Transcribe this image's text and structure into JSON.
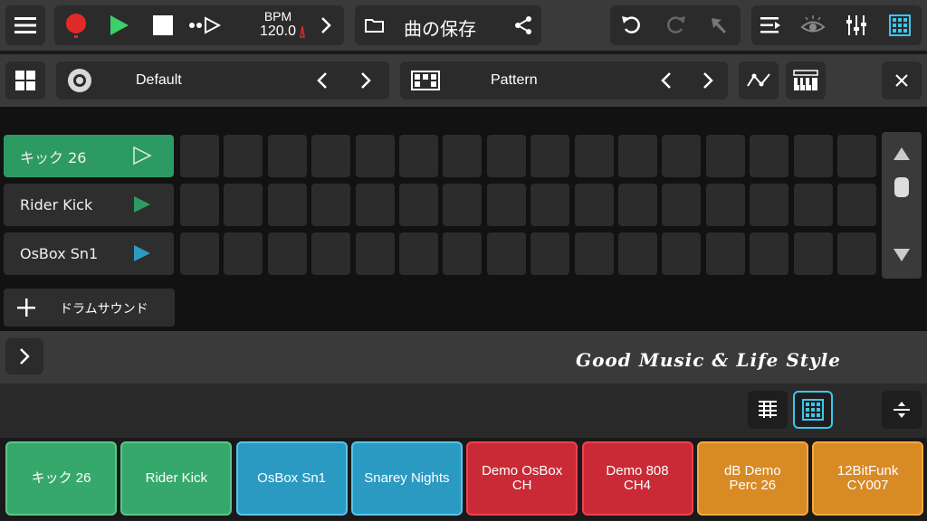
{
  "toolbar": {
    "bpm_label": "BPM",
    "bpm_value": "120.0",
    "song_title": "曲の保存"
  },
  "kit": {
    "name": "Default",
    "pattern": "Pattern"
  },
  "tracks": [
    {
      "name": "キック 26",
      "active": true,
      "play_color": "#2e9a63"
    },
    {
      "name": "Rider Kick",
      "active": false,
      "play_color": "#2e9a63"
    },
    {
      "name": "OsBox Sn1",
      "active": false,
      "play_color": "#2b9ac2"
    }
  ],
  "add_drum_sound": "ドラムサウンド",
  "watermark": "Good Music & Life Style",
  "pads": [
    {
      "label": "キック 26",
      "color": "green"
    },
    {
      "label": "Rider Kick",
      "color": "green"
    },
    {
      "label": "OsBox Sn1",
      "color": "blue"
    },
    {
      "label": "Snarey Nights",
      "color": "blue"
    },
    {
      "label": "Demo OsBox\nCH",
      "color": "red"
    },
    {
      "label": "Demo 808\nCH4",
      "color": "red"
    },
    {
      "label": "dB Demo\nPerc 26",
      "color": "orange"
    },
    {
      "label": "12BitFunk\nCY007",
      "color": "orange"
    }
  ]
}
